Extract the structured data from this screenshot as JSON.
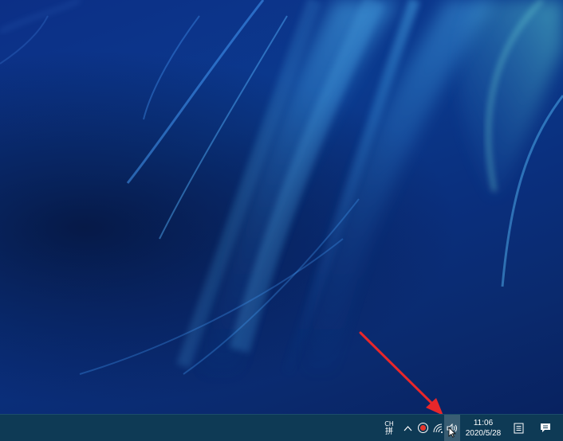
{
  "taskbar": {
    "ime": {
      "language": "CH",
      "mode": "拼"
    },
    "tray_icons": [
      "chevron-up-icon",
      "screen-record-icon",
      "network-icon",
      "volume-icon"
    ],
    "clock": {
      "time": "11:06",
      "date": "2020/5/28"
    },
    "right_icons": [
      "notes-icon",
      "action-center-icon"
    ]
  },
  "annotation": {
    "color": "#e8272a",
    "points_to": "volume-icon"
  },
  "colors": {
    "taskbar": "#0e3a55",
    "desktop": "#0b3a8e"
  }
}
